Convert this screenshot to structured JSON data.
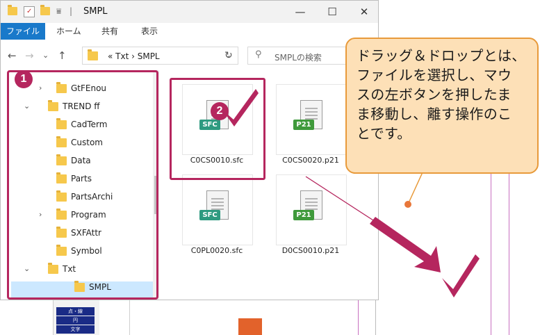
{
  "window": {
    "title": "SMPL",
    "title_separator": "|",
    "controls": {
      "minimize": "—",
      "maximize": "☐",
      "close": "✕"
    }
  },
  "ribbon": {
    "tabs": [
      "ファイル",
      "ホーム",
      "共有",
      "表示"
    ],
    "accent": "#1979ca"
  },
  "address": {
    "path": "«  Txt  ›  SMPL",
    "dropdown": "⌄",
    "refresh": "↻",
    "search_placeholder": "SMPLの検索"
  },
  "tree": [
    {
      "label": "GtFEnou",
      "chevron": "›",
      "indent": 1
    },
    {
      "label": "TREND ff",
      "chevron": "⌄",
      "indent": 0
    },
    {
      "label": "CadTerm",
      "chevron": "",
      "indent": 1
    },
    {
      "label": "Custom",
      "chevron": "",
      "indent": 1
    },
    {
      "label": "Data",
      "chevron": "",
      "indent": 1
    },
    {
      "label": "Parts",
      "chevron": "",
      "indent": 1
    },
    {
      "label": "PartsArchi",
      "chevron": "",
      "indent": 1
    },
    {
      "label": "Program",
      "chevron": "›",
      "indent": 1
    },
    {
      "label": "SXFAttr",
      "chevron": "",
      "indent": 1
    },
    {
      "label": "Symbol",
      "chevron": "",
      "indent": 1
    },
    {
      "label": "Txt",
      "chevron": "⌄",
      "indent": 0
    },
    {
      "label": "SMPL",
      "chevron": "",
      "indent": 2,
      "selected": true
    }
  ],
  "files": [
    {
      "name": "C0CS0010.sfc",
      "badge": "SFC"
    },
    {
      "name": "C0CS0020.p21",
      "badge": "P21"
    },
    {
      "name": "C0PL0020.sfc",
      "badge": "SFC"
    },
    {
      "name": "D0CS0010.p21",
      "badge": "P21"
    }
  ],
  "steps": [
    "1",
    "2"
  ],
  "callout": {
    "lines": [
      "ドラッグ＆ドロップとは、",
      "ファイルを選択し、マウ",
      "スの左ボタンを押したま",
      "ま移動し、離す操作のこ",
      "とです。"
    ]
  },
  "cad_panel": [
    "点・線",
    "円",
    "文字"
  ],
  "colors": {
    "highlight": "#b5265e",
    "callout_fill": "#fde0b7",
    "callout_border": "#e89a3a",
    "selection": "#cce8ff"
  }
}
